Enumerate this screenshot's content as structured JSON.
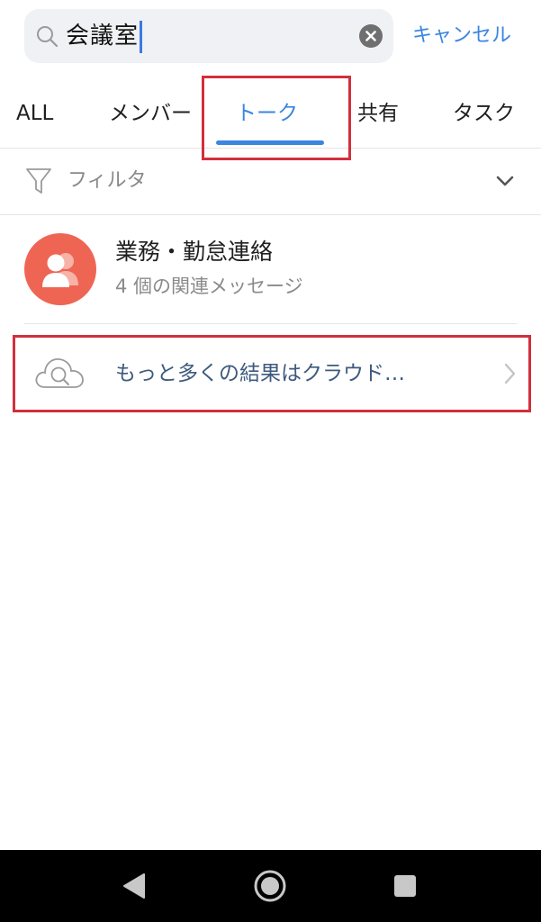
{
  "search": {
    "query": "会議室",
    "cancel_label": "キャンセル"
  },
  "tabs": [
    {
      "label": "ALL",
      "active": false
    },
    {
      "label": "メンバー",
      "active": false
    },
    {
      "label": "トーク",
      "active": true
    },
    {
      "label": "共有",
      "active": false
    },
    {
      "label": "タスク",
      "active": false
    }
  ],
  "filter": {
    "label": "フィルタ"
  },
  "results": [
    {
      "title": "業務・勤怠連絡",
      "subtitle": "4 個の関連メッセージ",
      "avatar_color": "#ef6553"
    }
  ],
  "cloud_search": {
    "label": "もっと多くの結果はクラウド…"
  },
  "colors": {
    "accent": "#3a86e0",
    "highlight": "#d32f3c",
    "avatar": "#ef6553",
    "cloud_text": "#3e5a7e"
  },
  "icons": [
    "search-icon",
    "clear-icon",
    "filter-icon",
    "chevron-down-icon",
    "group-avatar-icon",
    "cloud-search-icon",
    "chevron-right-icon",
    "back-icon",
    "home-icon",
    "recents-icon"
  ]
}
